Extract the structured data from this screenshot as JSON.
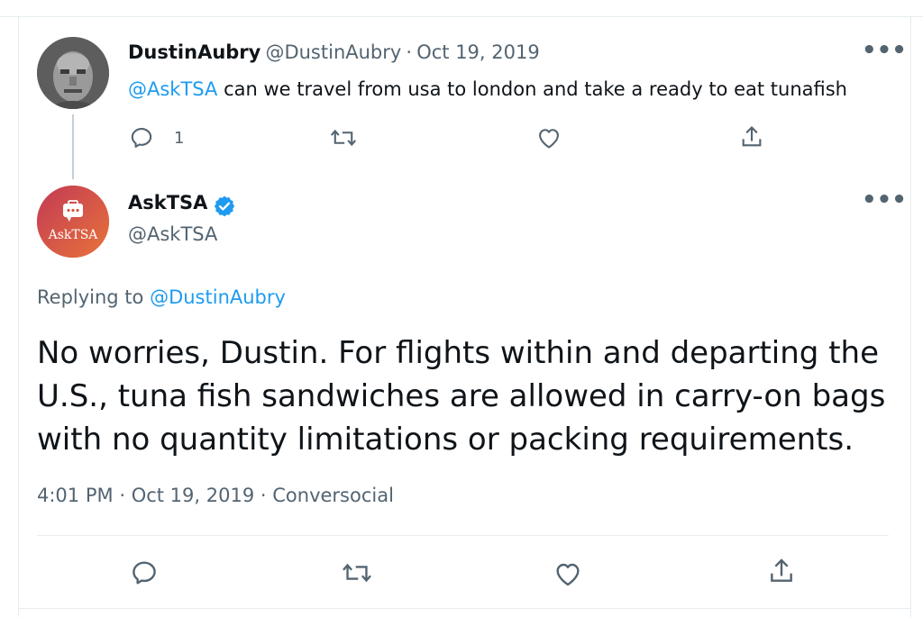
{
  "tweet1": {
    "display_name": "DustinAubry",
    "handle": "@DustinAubry",
    "separator": "·",
    "date": "Oct 19, 2019",
    "mention": "@AskTSA",
    "text": " can we travel from usa to london and take a ready to eat tunafish",
    "reply_count": "1",
    "more": "•••"
  },
  "tweet2": {
    "display_name": "AskTSA",
    "handle": "@AskTSA",
    "avatar_label_ask": "Ask",
    "avatar_label_tsa": "TSA",
    "replying_prefix": "Replying to ",
    "replying_to": "@DustinAubry",
    "line1": "No worries, Dustin. For flights within and departing the",
    "line2": "U.S., tuna fish sandwiches are allowed in carry-on bags",
    "line3": "with no quantity limitations or packing requirements.",
    "time": "4:01 PM",
    "separator": "·",
    "date": "Oct 19, 2019",
    "source": "Conversocial",
    "more": "•••"
  },
  "icons": {
    "reply": "reply-icon",
    "retweet": "retweet-icon",
    "like": "heart-icon",
    "share": "share-icon",
    "verified": "verified-badge-icon"
  },
  "colors": {
    "link": "#1d9bf0",
    "muted": "#536471",
    "verified": "#1d9bf0",
    "asktsa_avatar": "#d8553e"
  }
}
